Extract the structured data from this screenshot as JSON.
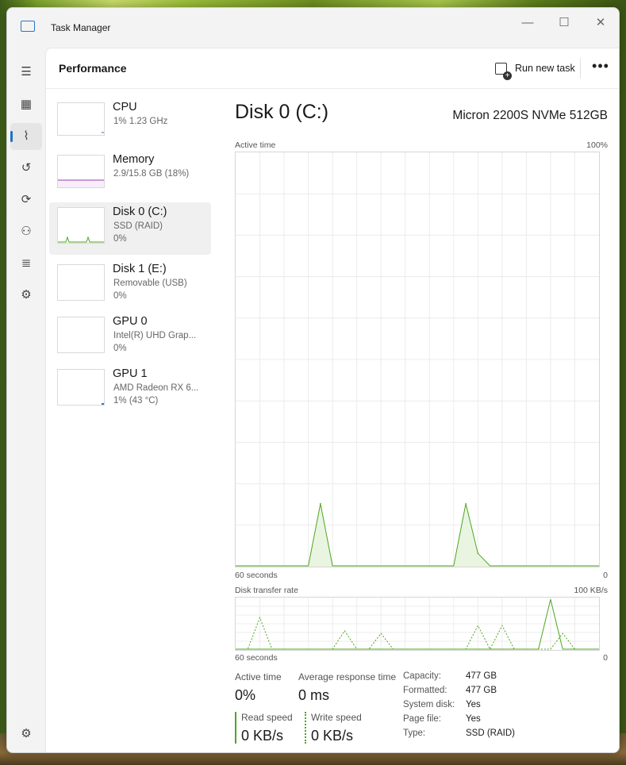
{
  "window": {
    "title": "Task Manager",
    "controls": {
      "minimize": "—",
      "maximize": "☐",
      "close": "✕"
    }
  },
  "nav": {
    "items": [
      {
        "icon": "hamburger-icon",
        "glyph": "☰"
      },
      {
        "icon": "processes-icon",
        "glyph": "▦"
      },
      {
        "icon": "performance-icon",
        "glyph": "⌇"
      },
      {
        "icon": "app-history-icon",
        "glyph": "↺"
      },
      {
        "icon": "startup-apps-icon",
        "glyph": "⟳"
      },
      {
        "icon": "users-icon",
        "glyph": "⚇"
      },
      {
        "icon": "details-icon",
        "glyph": "≣"
      },
      {
        "icon": "services-icon",
        "glyph": "⚙"
      },
      {
        "icon": "settings-icon",
        "glyph": "⚙"
      }
    ]
  },
  "header": {
    "title": "Performance",
    "run_task": "Run new task",
    "more": "•••"
  },
  "devices": [
    {
      "name": "CPU",
      "sub": "1% 1.23 GHz",
      "val": ""
    },
    {
      "name": "Memory",
      "sub": "2.9/15.8 GB (18%)",
      "val": ""
    },
    {
      "name": "Disk 0 (C:)",
      "sub": "SSD (RAID)",
      "val": "0%"
    },
    {
      "name": "Disk 1 (E:)",
      "sub": "Removable (USB)",
      "val": "0%"
    },
    {
      "name": "GPU 0",
      "sub": "Intel(R) UHD Grap...",
      "val": "0%"
    },
    {
      "name": "GPU 1",
      "sub": "AMD Radeon RX 6...",
      "val": "1% (43 °C)"
    }
  ],
  "main": {
    "title": "Disk 0 (C:)",
    "model": "Micron 2200S NVMe 512GB",
    "active_time_label": "Active time",
    "active_time_max": "100%",
    "seconds_label": "60 seconds",
    "zero": "0",
    "transfer_label": "Disk transfer rate",
    "transfer_max": "100 KB/s",
    "colors": {
      "active_line": "#4da61f",
      "active_fill": "#eaf5e1"
    }
  },
  "chart_data": [
    {
      "type": "area",
      "title": "Active time",
      "ylabel": "Active time",
      "ylim": [
        0,
        100
      ],
      "x": [
        60,
        58,
        56,
        54,
        52,
        50,
        48,
        46,
        44,
        42,
        40,
        38,
        36,
        34,
        32,
        30,
        28,
        26,
        24,
        22,
        20,
        18,
        16,
        14,
        12,
        10,
        8,
        6,
        4,
        2,
        0
      ],
      "series": [
        {
          "values": [
            0,
            0,
            0,
            0,
            0,
            0,
            0,
            15,
            0,
            0,
            0,
            0,
            0,
            0,
            0,
            0,
            0,
            0,
            0,
            15,
            3,
            0,
            0,
            0,
            0,
            0,
            0,
            0,
            0,
            0,
            0
          ]
        }
      ]
    },
    {
      "type": "line",
      "title": "Disk transfer rate",
      "ylabel": "Disk transfer rate",
      "ylim": [
        0,
        100
      ],
      "x": [
        60,
        58,
        56,
        54,
        52,
        50,
        48,
        46,
        44,
        42,
        40,
        38,
        36,
        34,
        32,
        30,
        28,
        26,
        24,
        22,
        20,
        18,
        16,
        14,
        12,
        10,
        8,
        6,
        4,
        2,
        0
      ],
      "series": [
        {
          "values": [
            0,
            0,
            60,
            0,
            0,
            0,
            0,
            0,
            0,
            35,
            0,
            0,
            30,
            0,
            0,
            0,
            0,
            0,
            0,
            0,
            45,
            0,
            45,
            0,
            0,
            0,
            0,
            30,
            0,
            0,
            0
          ]
        },
        {
          "values": [
            0,
            0,
            0,
            0,
            0,
            0,
            0,
            0,
            0,
            0,
            0,
            0,
            0,
            0,
            0,
            0,
            0,
            0,
            0,
            0,
            0,
            0,
            0,
            0,
            0,
            0,
            95,
            0,
            0,
            0,
            0
          ]
        }
      ]
    }
  ],
  "stats": {
    "active_time": {
      "label": "Active time",
      "value": "0%"
    },
    "avg_response": {
      "label": "Average response time",
      "value": "0 ms"
    },
    "read_speed": {
      "label": "Read speed",
      "value": "0 KB/s"
    },
    "write_speed": {
      "label": "Write speed",
      "value": "0 KB/s"
    }
  },
  "properties": [
    {
      "label": "Capacity:",
      "value": "477 GB"
    },
    {
      "label": "Formatted:",
      "value": "477 GB"
    },
    {
      "label": "System disk:",
      "value": "Yes"
    },
    {
      "label": "Page file:",
      "value": "Yes"
    },
    {
      "label": "Type:",
      "value": "SSD (RAID)"
    }
  ]
}
